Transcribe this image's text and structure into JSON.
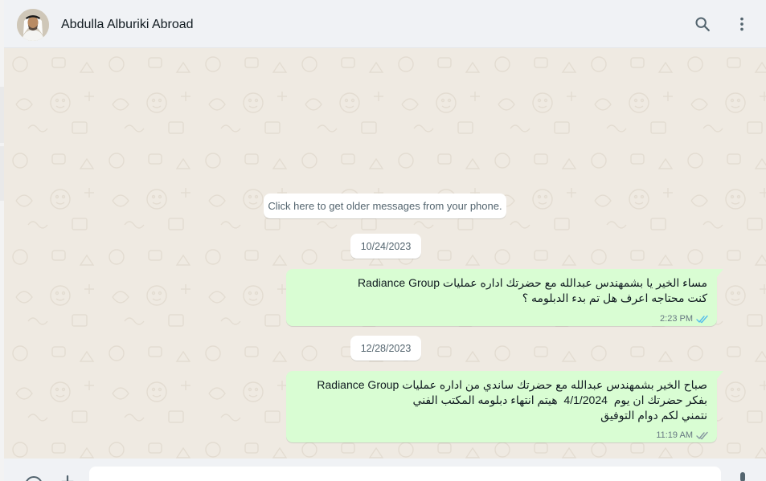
{
  "header": {
    "contact_name": "Abdulla Alburiki Abroad",
    "icons": [
      "avatar",
      "search-icon",
      "menu-icon"
    ]
  },
  "chat": {
    "older_messages_label": "Click here to get older messages from your phone.",
    "messages": [
      {
        "date": "10/24/2023",
        "lines": [
          "مساء الخير يا بشمهندس عبدالله مع حضرتك اداره عمليات Radiance Group",
          "كنت محتاجه اعرف هل تم بدء الدبلومه ؟"
        ],
        "time": "2:23 PM",
        "status": "read"
      },
      {
        "date": "12/28/2023",
        "lines": [
          "صباح الخير بشمهندس عبدالله مع حضرتك ساندي من اداره عمليات Radiance Group",
          "بفكر حضرتك ان يوم  4/1/2024  هيتم انتهاء دبلومه المكتب الفني",
          "نتمني لكم دوام التوفيق"
        ],
        "time": "11:19 AM",
        "status": "read"
      }
    ]
  },
  "colors": {
    "header_bg": "#f0f2f5",
    "chat_bg": "#efeae2",
    "outgoing_bubble": "#d9fdd3",
    "read_ticks": "#53bdeb"
  }
}
